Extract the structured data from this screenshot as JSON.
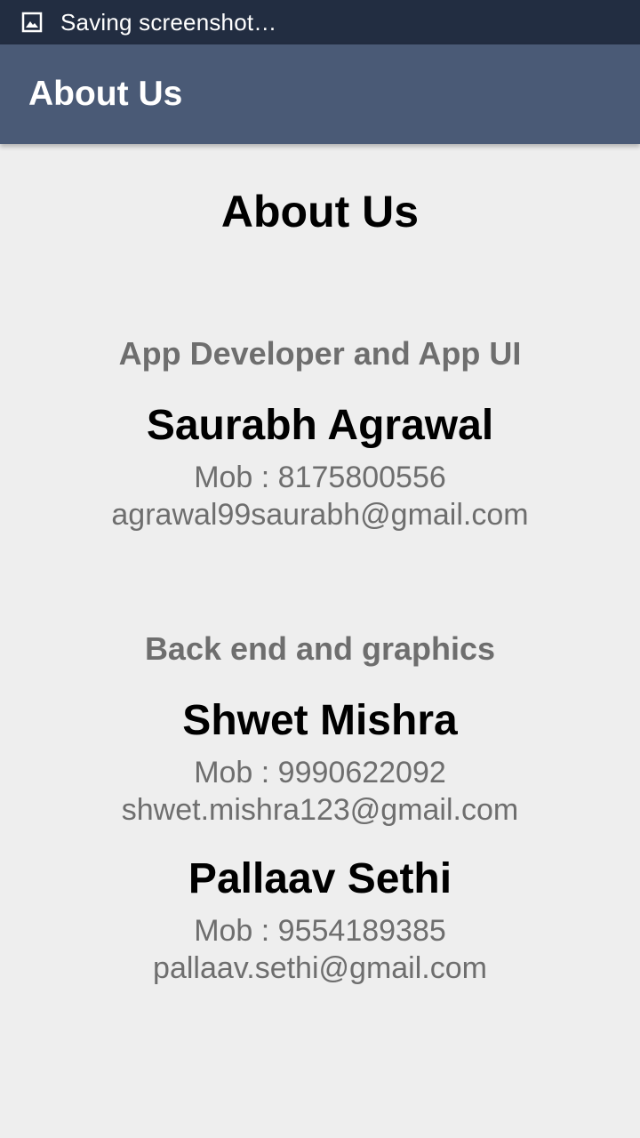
{
  "status_bar": {
    "icon": "image-icon",
    "text": "Saving screenshot…"
  },
  "app_bar": {
    "title": "About Us"
  },
  "page": {
    "heading": "About Us",
    "sections": [
      {
        "title": "App Developer and App UI",
        "people": [
          {
            "name": "Saurabh Agrawal",
            "mobile": "Mob : 8175800556",
            "email": "agrawal99saurabh@gmail.com"
          }
        ]
      },
      {
        "title": "Back end and graphics",
        "people": [
          {
            "name": "Shwet Mishra",
            "mobile": "Mob : 9990622092",
            "email": "shwet.mishra123@gmail.com"
          },
          {
            "name": "Pallaav Sethi",
            "mobile": "Mob : 9554189385",
            "email": "pallaav.sethi@gmail.com"
          }
        ]
      }
    ]
  },
  "colors": {
    "status_bar": "#222d41",
    "app_bar": "#4a5a76",
    "background": "#eeeeee",
    "secondary_text": "#6e6e6e"
  }
}
